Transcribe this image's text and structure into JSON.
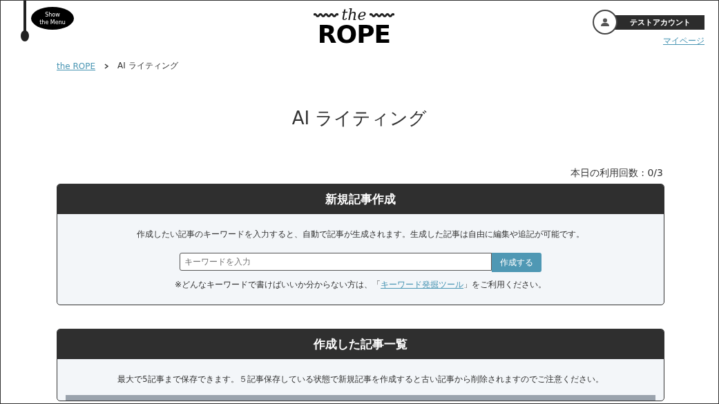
{
  "header": {
    "menu_bubble": [
      "Show",
      "the Menu"
    ],
    "logo": {
      "small": "the",
      "big": "ROPE"
    },
    "account": {
      "name": "テストアカウント",
      "mypage_link": "マイページ"
    }
  },
  "breadcrumb": [
    {
      "label": "the ROPE",
      "kind": "link"
    },
    {
      "label": "AI ライティング",
      "kind": "current"
    }
  ],
  "page_title": "AI ライティング",
  "usage": "本日の利用回数 : 0/3",
  "new_article": {
    "title": "新規記事作成",
    "description": "作成したい記事のキーワードを入力すると、自動で記事が生成されます。生成した記事は自由に編集や追記が可能です。",
    "placeholder": "キーワードを入力",
    "button": "作成する",
    "note_before": "※どんなキーワードで書けばいいか分からない方は、「",
    "note_link": "キーワード発掘ツール",
    "note_after": "」をご利用ください。"
  },
  "article_list": {
    "title": "作成した記事一覧",
    "description": "最大で5記事まで保存できます。５記事保存している状態で新規記事を作成すると古い記事から削除されますのでご注意ください。"
  }
}
